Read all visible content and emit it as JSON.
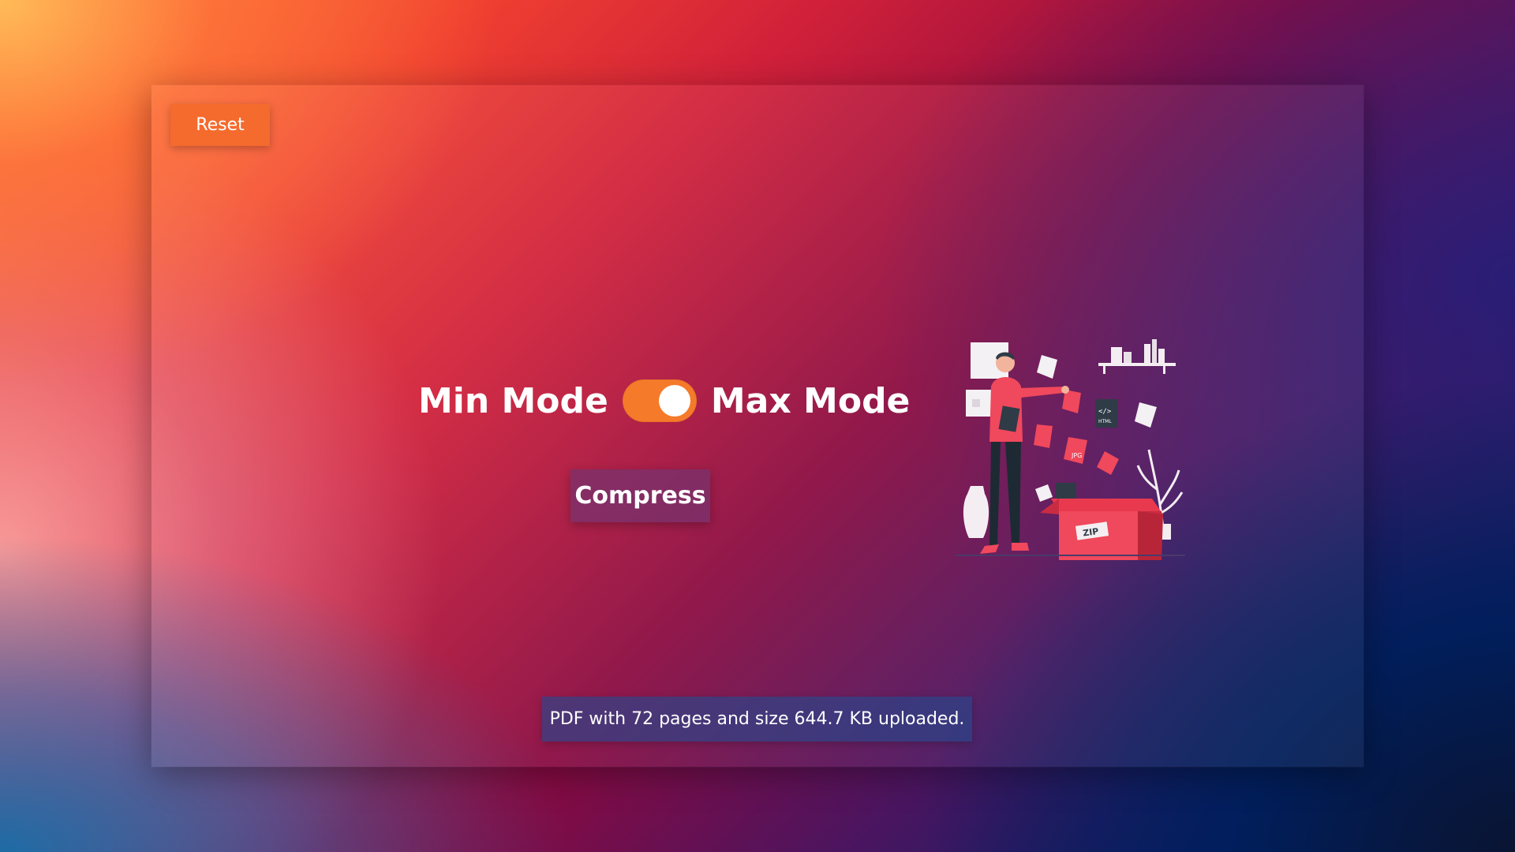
{
  "toolbar": {
    "reset_label": "Reset"
  },
  "mode_switch": {
    "min_label": "Min Mode",
    "max_label": "Max Mode",
    "selected": "Max Mode"
  },
  "actions": {
    "compress_label": "Compress"
  },
  "status": {
    "message": "PDF with 72 pages and size 644.7 KB uploaded."
  },
  "illustration": {
    "icon": "file-compression-illustration",
    "tags": [
      "HTML",
      "JPG",
      "ZIP"
    ]
  },
  "colors": {
    "accent": "#f56a2d",
    "toggle_on": "#f57a2a",
    "compress_button": "#7a3270",
    "status_bg": "#28468c"
  }
}
